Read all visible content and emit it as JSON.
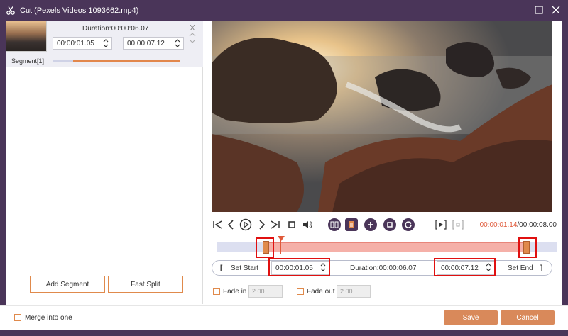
{
  "window": {
    "title": "Cut (Pexels Videos 1093662.mp4)"
  },
  "segment_card": {
    "duration_label": "Duration:00:00:06.07",
    "start": "00:00:01.05",
    "end": "00:00:07.12",
    "segment_label": "Segment[1]"
  },
  "left_buttons": {
    "add_segment": "Add Segment",
    "fast_split": "Fast Split"
  },
  "playback": {
    "current_time": "00:00:01.14",
    "total_time": "/00:00:08.00"
  },
  "range": {
    "set_start_bracket": "[",
    "set_start": "Set Start",
    "start_value": "00:00:01.05",
    "duration": "Duration:00:00:06.07",
    "end_value": "00:00:07.12",
    "set_end": "Set End",
    "set_end_bracket": "]"
  },
  "fade": {
    "fade_in_label": "Fade in",
    "fade_in_value": "2.00",
    "fade_out_label": "Fade out",
    "fade_out_value": "2.00"
  },
  "footer": {
    "merge_label": "Merge into one",
    "save": "Save",
    "cancel": "Cancel"
  },
  "colors": {
    "titlebar": "#4a3559",
    "accent": "#d9895a",
    "highlight": "#e01010",
    "time_current": "#e05a3a"
  },
  "icons": [
    "scissors-icon",
    "maximize-icon",
    "close-icon",
    "skip-start-icon",
    "prev-frame-icon",
    "play-icon",
    "next-frame-icon",
    "skip-end-icon",
    "stop-icon",
    "volume-icon",
    "split-icon",
    "copy-icon",
    "add-icon",
    "duplicate-icon",
    "reset-icon",
    "play-segment-icon",
    "segment-marker-icon"
  ]
}
